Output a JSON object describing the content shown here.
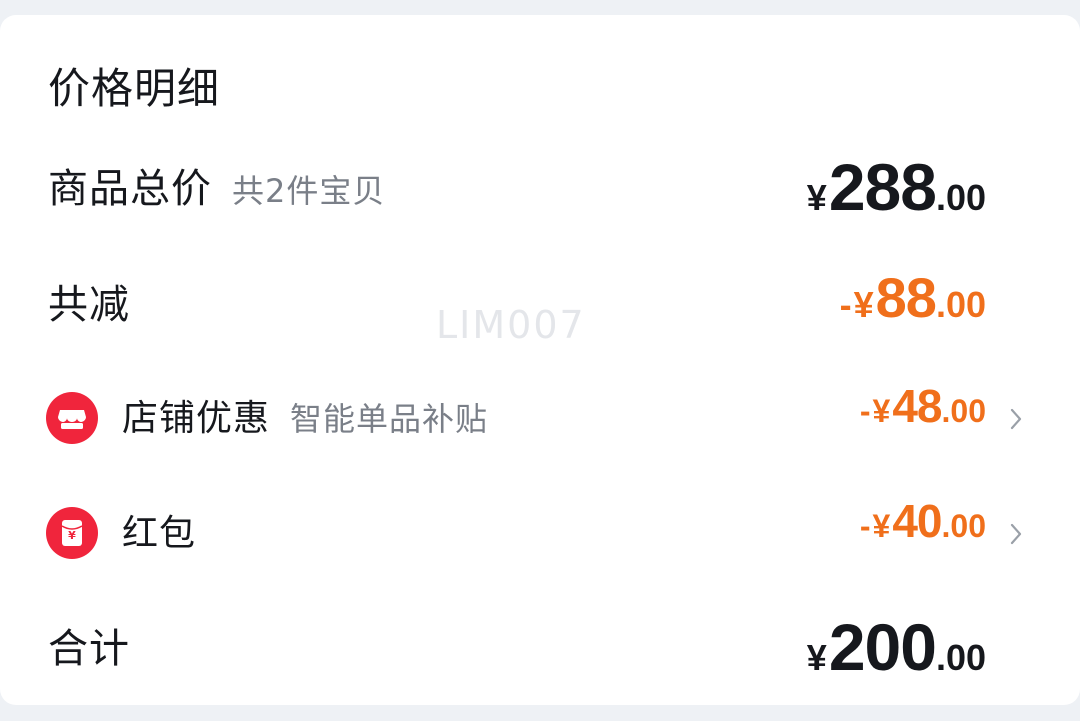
{
  "title": "价格明细",
  "rows": {
    "goods_total": {
      "label": "商品总价",
      "sub": "共2件宝贝",
      "currency": "¥",
      "int": "288",
      "dec": ".00"
    },
    "total_reduce": {
      "label": "共减",
      "sign": "-",
      "currency": "¥",
      "int": "88",
      "dec": ".00"
    },
    "store_discount": {
      "label": "店铺优惠",
      "sub": "智能单品补贴",
      "sign": "-",
      "currency": "¥",
      "int": "48",
      "dec": ".00",
      "icon": "store-icon"
    },
    "red_packet": {
      "label": "红包",
      "sign": "-",
      "currency": "¥",
      "int": "40",
      "dec": ".00",
      "icon": "red-packet-icon",
      "icon_text": "¥"
    },
    "total": {
      "label": "合计",
      "currency": "¥",
      "int": "200",
      "dec": ".00"
    }
  },
  "watermark": "LIM007",
  "colors": {
    "text": "#16181d",
    "secondary": "#7a7f88",
    "discount": "#f06f1b",
    "icon_bg": "#f0253c"
  }
}
